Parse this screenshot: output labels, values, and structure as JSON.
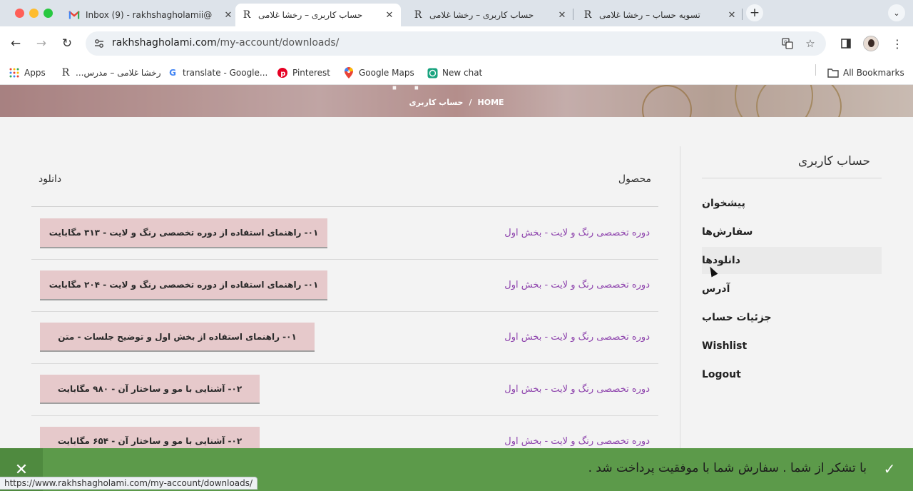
{
  "browser": {
    "tabs": [
      {
        "title": "Inbox (9) - rakhshagholamii@",
        "favicon": "gmail-icon",
        "active": false
      },
      {
        "title": "حساب کاربری – رخشا غلامی",
        "favicon": "R",
        "active": true
      },
      {
        "title": "حساب کاربری – رخشا غلامی",
        "favicon": "R",
        "active": false
      },
      {
        "title": "تسویه حساب – رخشا غلامی",
        "favicon": "R",
        "active": false
      }
    ],
    "url_domain": "rakhshagholami.com",
    "url_path": "/my-account/downloads/",
    "bookmarks": [
      {
        "label": "Apps",
        "icon": "apps-grid-icon"
      },
      {
        "label": "رخشا غلامی – مدرس...",
        "icon": "R"
      },
      {
        "label": "translate - Google...",
        "icon": "google-icon"
      },
      {
        "label": "Pinterest",
        "icon": "pinterest-icon"
      },
      {
        "label": "Google Maps",
        "icon": "maps-icon"
      },
      {
        "label": "New chat",
        "icon": "chatgpt-icon"
      }
    ],
    "all_bookmarks": "All Bookmarks",
    "status_url": "https://www.rakhshagholami.com/my-account/downloads/"
  },
  "hero": {
    "breadcrumb_home": "HOME",
    "breadcrumb_sep": "/",
    "breadcrumb_current": "حساب کاربری"
  },
  "account": {
    "title": "حساب کاربری",
    "menu": [
      {
        "label": "پیشخوان",
        "active": false
      },
      {
        "label": "سفارش‌ها",
        "active": false
      },
      {
        "label": "دانلودها",
        "active": true
      },
      {
        "label": "آدرس",
        "active": false
      },
      {
        "label": "جزئیات حساب",
        "active": false
      },
      {
        "label": "Wishlist",
        "active": false
      },
      {
        "label": "Logout",
        "active": false
      }
    ]
  },
  "downloads": {
    "col_product": "محصول",
    "col_download": "دانلود",
    "rows": [
      {
        "product": "دوره تخصصی رنگ و لایت - بخش اول",
        "file": "۰۱- راهنمای استفاده از دوره تخصصی رنگ و لایت - ۳۱۳ مگابایت"
      },
      {
        "product": "دوره تخصصی رنگ و لایت - بخش اول",
        "file": "۰۱- راهنمای استفاده از دوره تخصصی رنگ و لایت - ۲۰۴ مگابایت"
      },
      {
        "product": "دوره تخصصی رنگ و لایت - بخش اول",
        "file": "۰۱- راهنمای استفاده از بخش اول و توضیح جلسات - متن"
      },
      {
        "product": "دوره تخصصی رنگ و لایت - بخش اول",
        "file": "۰۲- آشنایی با مو و ساختار آن - ۹۸۰ مگابایت"
      },
      {
        "product": "دوره تخصصی رنگ و لایت - بخش اول",
        "file": "۰۲- آشنایی با مو و ساختار آن - ۶۵۴ مگابایت"
      }
    ]
  },
  "notice": {
    "message": "با تشکر از شما . سفارش شما با موفقیت پرداخت شد .",
    "color": "#5c9a4a"
  }
}
